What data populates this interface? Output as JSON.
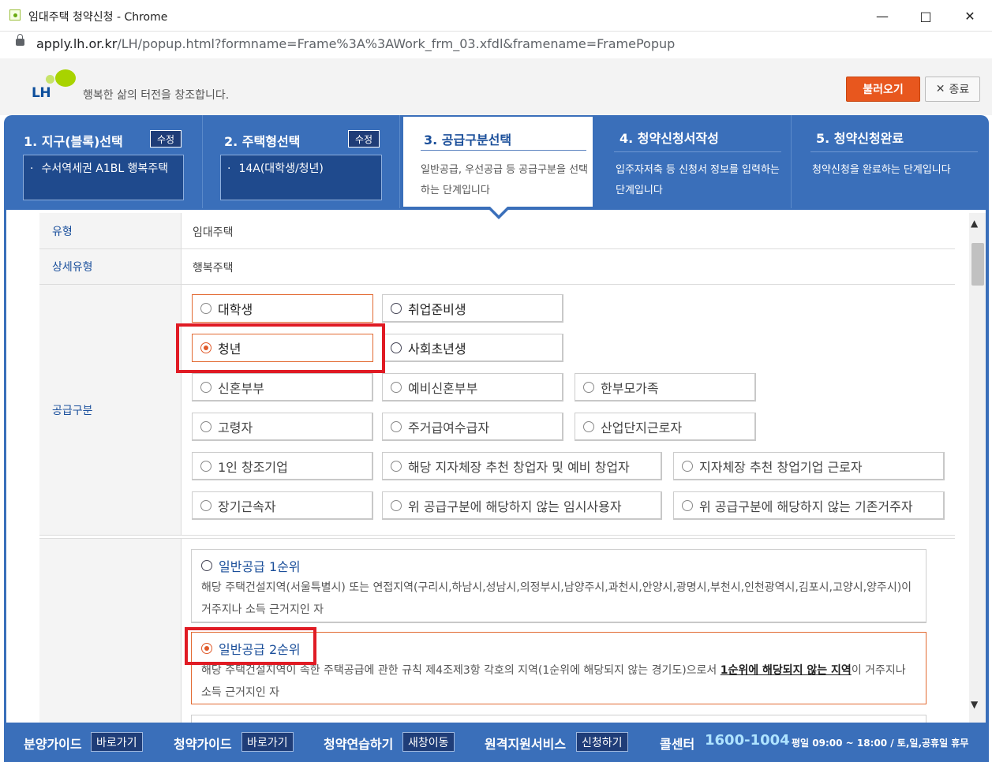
{
  "window": {
    "title": "임대주택 청약신청 - Chrome",
    "url_host": "apply.lh.or.kr",
    "url_path": "/LH/popup.html?formname=Frame%3A%3AWork_frm_03.xfdl&framename=FramePopup"
  },
  "header": {
    "logo": "LH",
    "slogan": "행복한 삶의 터전을 창조합니다.",
    "load_button": "불러오기",
    "close_button": "종료",
    "close_glyph": "✕"
  },
  "steps": [
    {
      "title": "1. 지구(블록)선택",
      "badge": "수정",
      "item": "수서역세권 A1BL 행복주택"
    },
    {
      "title": "2. 주택형선택",
      "badge": "수정",
      "item": "14A(대학생/청년)"
    },
    {
      "title": "3. 공급구분선택",
      "desc": "일반공급, 우선공급 등 공급구분을 선택하는 단계입니다"
    },
    {
      "title": "4. 청약신청서작성",
      "desc": "입주자저축 등 신청서 정보를 입력하는 단계입니다"
    },
    {
      "title": "5. 청약신청완료",
      "desc": "청약신청을 완료하는 단계입니다"
    }
  ],
  "form": {
    "type_label": "유형",
    "type_value": "임대주택",
    "detail_label": "상세유형",
    "detail_value": "행복주택",
    "supply_label": "공급구분",
    "options": [
      "대학생",
      "취업준비생",
      "청년",
      "사회초년생",
      "신혼부부",
      "예비신혼부부",
      "한부모가족",
      "고령자",
      "주거급여수급자",
      "산업단지근로자",
      "1인 창조기업",
      "해당 지자체장 추천 창업자 및 예비 창업자",
      "지자체장 추천 창업기업 근로자",
      "장기근속자",
      "위 공급구분에 해당하지 않는 임시사용자",
      "위 공급구분에 해당하지 않는 기존거주자"
    ],
    "selected_option": "청년",
    "ranks": [
      {
        "title": "일반공급 1순위",
        "desc": "해당 주택건설지역(서울특별시) 또는 연접지역(구리시,하남시,성남시,의정부시,남양주시,과천시,안양시,광명시,부천시,인천광역시,김포시,고양시,양주시)이 거주지나 소득 근거지인 자"
      },
      {
        "title": "일반공급 2순위",
        "desc_a": "해당 주택건설지역이 속한 주택공급에 관한 규칙 제4조제3항 각호의 지역(1순위에 해당되지 않는 경기도)으로서 ",
        "desc_u": "1순위에 해당되지 않는 지역",
        "desc_b": "이 거주지나 소득 근거지인 자"
      }
    ],
    "selected_rank": "일반공급 2순위"
  },
  "footer": {
    "guide1": "분양가이드",
    "guide1_btn": "바로가기",
    "guide2": "청약가이드",
    "guide2_btn": "바로가기",
    "practice": "청약연습하기",
    "practice_btn": "새창이동",
    "remote": "원격지원서비스",
    "remote_btn": "신청하기",
    "callcenter": "콜센터",
    "phone": "1600-1004",
    "hours": "평일 09:00 ~ 18:00 / 토,일,공휴일 휴무"
  },
  "colors": {
    "accent_blue": "#3a6fba",
    "accent_orange": "#e8571e",
    "highlight_red": "#e01b24"
  }
}
